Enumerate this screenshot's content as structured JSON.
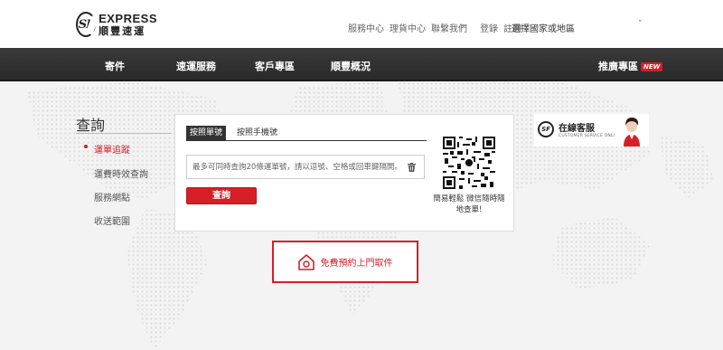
{
  "brand": {
    "en": "EXPRESS",
    "zh": "順豐速運",
    "mark": "SF"
  },
  "toplinks": [
    "服務中心",
    "理貨中心",
    "聯繫我們"
  ],
  "auth": [
    "登錄",
    "註冊"
  ],
  "region": {
    "label": "選擇國家或地區",
    "caret": "˅"
  },
  "nav": {
    "items": [
      "寄件",
      "速運服務",
      "客戶專區",
      "順豐概況"
    ],
    "promo": "推廣專區",
    "promo_badge": "NEW"
  },
  "page": {
    "title": "查詢"
  },
  "sidebar": {
    "items": [
      "運單追蹤",
      "運費時效查詢",
      "服務網點",
      "收送範圍"
    ]
  },
  "query": {
    "tab_active": "按照單號",
    "tab_inactive": "按照手機號",
    "placeholder": "最多可同時查詢20條運單號，請以逗號、空格或回車鍵隔開。",
    "submit": "查詢",
    "qr_caption": "簡易輕鬆 微信隨時隨地查單!"
  },
  "pickup": {
    "label": "免費預約上門取件"
  },
  "service": {
    "title": "在線客服",
    "subtitle": "CUSTOMER SERVICE ONLINE",
    "logo": "SF"
  },
  "colors": {
    "brand_red": "#d61f26",
    "nav_dark": "#2f2f2f"
  }
}
